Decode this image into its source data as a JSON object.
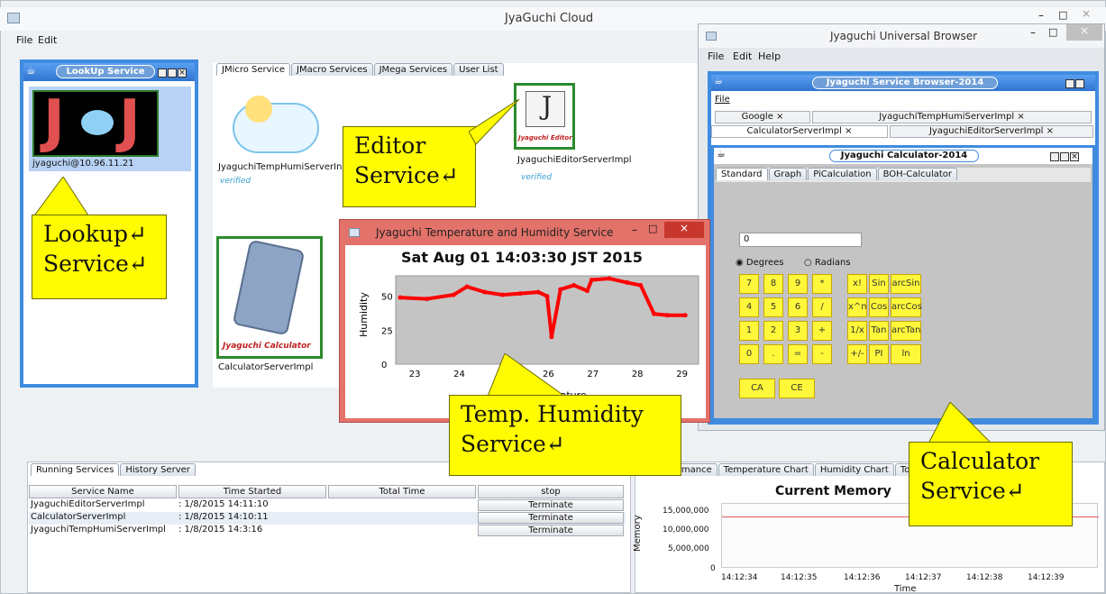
{
  "main_window": {
    "title": "JyaGuchi Cloud",
    "menu": [
      "File",
      "Edit"
    ]
  },
  "lookup": {
    "title": "LookUp Service",
    "host": "jyaguchi@10.96.11.21"
  },
  "service_tabs": [
    "JMicro Service",
    "JMacro Services",
    "JMega Services",
    "User List"
  ],
  "services": {
    "temp_humi": "JyaguchiTempHumiServerIn",
    "editor": "JyaguchiEditorServerImpl",
    "editor_logo": "Jyaguchi Editor",
    "calculator": "CalculatorServerImpl",
    "calculator_logo": "Jyaguchi Calculator",
    "verified": "verified"
  },
  "callouts": {
    "editor": [
      "Editor",
      "Service↵"
    ],
    "lookup": [
      "Lookup↵",
      "Service↵"
    ],
    "temp": [
      "Temp. Humidity",
      "Service↵"
    ],
    "calculator": [
      "Calculator",
      "Service↵"
    ]
  },
  "temp_window": {
    "title": "Jyaguchi Temperature and Humidity Service",
    "timestamp": "Sat Aug 01 14:03:30 JST 2015",
    "ylabel": "Humidity",
    "xlabel": "Temperature"
  },
  "chart_data": {
    "type": "line",
    "title": "Sat Aug 01 14:03:30 JST 2015",
    "xlabel": "Temperature",
    "ylabel": "Humidity",
    "xlim": [
      22.6,
      29.4
    ],
    "ylim": [
      0,
      65
    ],
    "xticks": [
      23,
      24,
      25,
      26,
      27,
      28,
      29
    ],
    "yticks": [
      0,
      25,
      50
    ],
    "series": [
      {
        "color": "#ff0000",
        "x": [
          22.7,
          23.3,
          23.9,
          24.2,
          24.6,
          25.0,
          25.4,
          25.8,
          26.0,
          26.1,
          26.3,
          26.6,
          26.9,
          27.0,
          27.4,
          27.8,
          28.1,
          28.4,
          28.7,
          29.1
        ],
        "y": [
          49,
          48,
          51,
          57,
          53,
          51,
          52,
          53,
          50,
          20,
          55,
          58,
          54,
          62,
          63,
          60,
          58,
          37,
          36,
          36
        ]
      }
    ]
  },
  "browser": {
    "title": "Jyaguchi Universal Browser",
    "menu": [
      "File",
      "Edit",
      "Help"
    ],
    "inner_title": "Jyaguchi Service Browser-2014",
    "inner_menu": "File",
    "tabs_row1": [
      "Google",
      "JyaguchiTempHumiServerImpl"
    ],
    "tabs_row2": [
      "CalculatorServerImpl",
      "JyaguchiEditorServerImpl"
    ],
    "close_mark": "×"
  },
  "calculator": {
    "title": "Jyaguchi Calculator-2014",
    "tabs": [
      "Standard",
      "Graph",
      "PiCalculation",
      "BOH-Calculator"
    ],
    "display": "0",
    "degrees": "Degrees",
    "radians": "Radians",
    "keys": [
      [
        "7",
        "8",
        "9",
        "*"
      ],
      [
        "4",
        "5",
        "6",
        "/"
      ],
      [
        "1",
        "2",
        "3",
        "+"
      ],
      [
        "0",
        ".",
        "=",
        "-"
      ]
    ],
    "fn_keys": [
      [
        "x!",
        "Sin",
        "arcSin"
      ],
      [
        "x^n",
        "Cos",
        "arcCos"
      ],
      [
        "1/x",
        "Tan",
        "arcTan"
      ],
      [
        "+/-",
        "PI",
        "ln"
      ]
    ],
    "ca": "CA",
    "ce": "CE"
  },
  "running": {
    "tabs": [
      "Running Services",
      "History Server"
    ],
    "headers": [
      "Service Name",
      "Time Started",
      "Total Time",
      "stop"
    ],
    "rows": [
      [
        "JyaguchiEditorServerImpl",
        ": 1/8/2015 14:11:10",
        "",
        "Terminate"
      ],
      [
        "CalculatorServerImpl",
        ": 1/8/2015 14:10:11",
        "",
        "Terminate"
      ],
      [
        "JyaguchiTempHumiServerImpl",
        ": 1/8/2015 14:3:16",
        "",
        "Terminate"
      ]
    ]
  },
  "memory": {
    "tabs": [
      "rmance",
      "Temperature Chart",
      "Humidity Chart",
      "TotalUs"
    ],
    "title": "Current Memory",
    "ylabel": "Memory",
    "xlabel": "Time",
    "yticks": [
      "15,000,000",
      "10,000,000",
      "5,000,000",
      "0"
    ],
    "xticks": [
      "14:12:34",
      "14:12:35",
      "14:12:36",
      "14:12:37",
      "14:12:38",
      "14:12:39"
    ]
  }
}
